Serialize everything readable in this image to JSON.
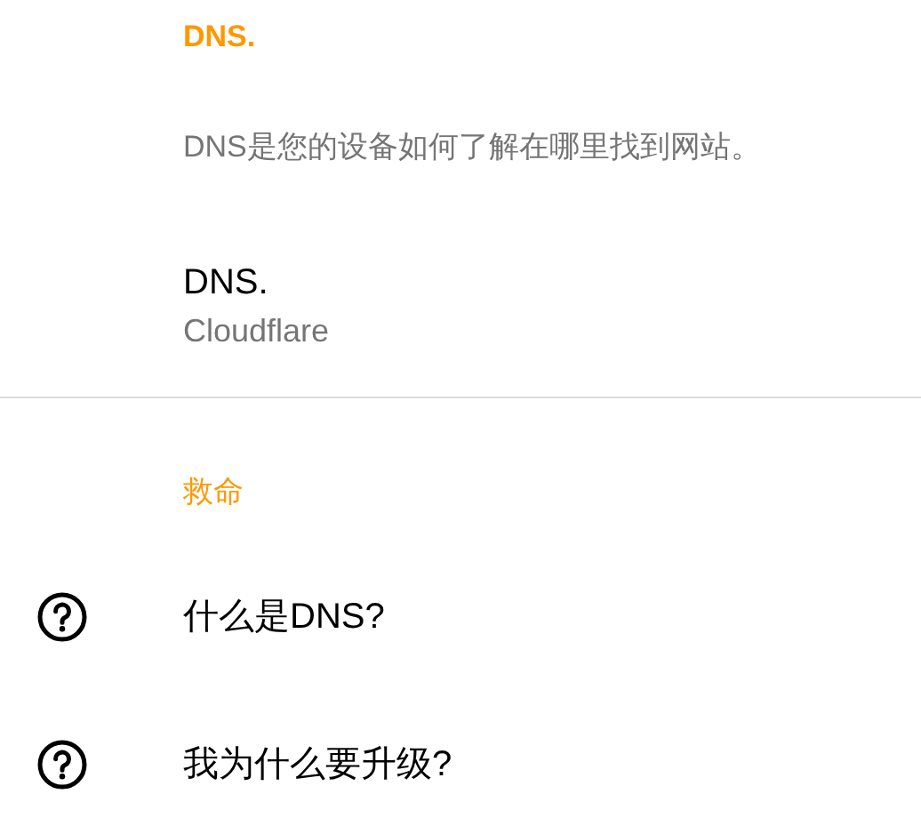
{
  "sections": [
    {
      "header": "DNS.",
      "items": [
        {
          "kind": "description",
          "text": "DNS是您的设备如何了解在哪里找到网站。"
        },
        {
          "kind": "setting",
          "title": "DNS.",
          "summary": "Cloudflare"
        }
      ]
    },
    {
      "header": "救命",
      "items": [
        {
          "kind": "help",
          "title": "什么是DNS?"
        },
        {
          "kind": "help",
          "title": "我为什么要升级?"
        }
      ]
    }
  ]
}
